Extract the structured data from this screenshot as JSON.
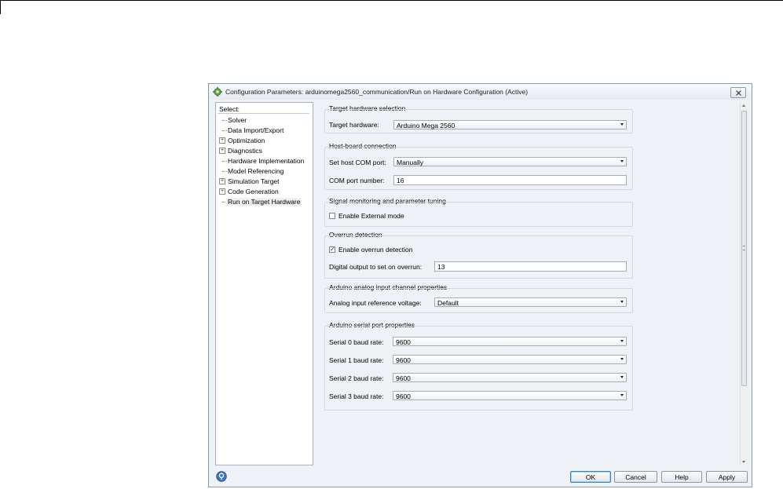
{
  "window": {
    "title": "Configuration Parameters: arduinomega2560_communication/Run on Hardware Configuration (Active)"
  },
  "tree": {
    "header": "Select:",
    "items": [
      {
        "label": "Solver",
        "expandable": false
      },
      {
        "label": "Data Import/Export",
        "expandable": false
      },
      {
        "label": "Optimization",
        "expandable": true
      },
      {
        "label": "Diagnostics",
        "expandable": true
      },
      {
        "label": "Hardware Implementation",
        "expandable": false
      },
      {
        "label": "Model Referencing",
        "expandable": false
      },
      {
        "label": "Simulation Target",
        "expandable": true
      },
      {
        "label": "Code Generation",
        "expandable": true
      },
      {
        "label": "Run on Target Hardware",
        "expandable": false,
        "selected": true
      }
    ]
  },
  "sections": {
    "target": {
      "title": "Target hardware selection",
      "hardware_label": "Target hardware:",
      "hardware_value": "Arduino Mega 2560"
    },
    "host": {
      "title": "Host-board connection",
      "com_port_label": "Set host COM port:",
      "com_port_value": "Manually",
      "com_number_label": "COM port number:",
      "com_number_value": "16"
    },
    "signal": {
      "title": "Signal monitoring and parameter tuning",
      "external_mode_label": "Enable External mode",
      "external_mode_checked": false
    },
    "overrun": {
      "title": "Overrun detection",
      "enable_label": "Enable overrun detection",
      "enable_checked": true,
      "digital_label": "Digital output to set on overrun:",
      "digital_value": "13"
    },
    "analog": {
      "title": "Arduino analog input channel properties",
      "ref_label": "Analog input reference voltage:",
      "ref_value": "Default"
    },
    "serial": {
      "title": "Arduino serial port properties",
      "ports": [
        {
          "label": "Serial 0 baud rate:",
          "value": "9600"
        },
        {
          "label": "Serial 1 baud rate:",
          "value": "9600"
        },
        {
          "label": "Serial 2 baud rate:",
          "value": "9600"
        },
        {
          "label": "Serial 3 baud rate:",
          "value": "9600"
        }
      ]
    }
  },
  "buttons": {
    "ok": "OK",
    "cancel": "Cancel",
    "help": "Help",
    "apply": "Apply"
  }
}
